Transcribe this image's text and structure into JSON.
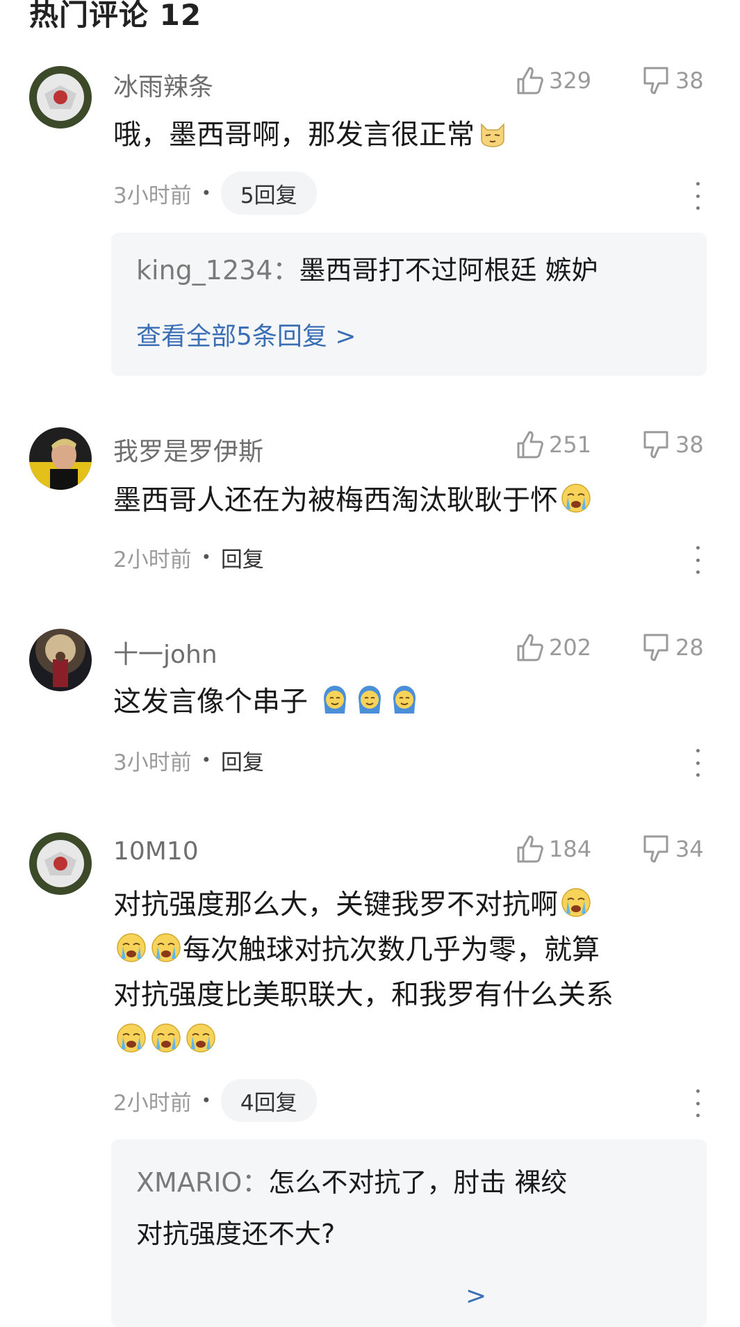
{
  "section": {
    "title": "热门评论 12"
  },
  "comments": [
    {
      "username": "冰雨辣条",
      "likes": "329",
      "dislikes": "38",
      "text": "哦，墨西哥啊，那发言很正常",
      "time": "3小时前",
      "reply_label": "5回复",
      "reply_preview": {
        "user": "king_1234：",
        "text": "墨西哥打不过阿根廷 嫉妒",
        "view_all": "查看全部5条回复 >"
      }
    },
    {
      "username": "我罗是罗伊斯",
      "likes": "251",
      "dislikes": "38",
      "text": "墨西哥人还在为被梅西淘汰耿耿于怀",
      "time": "2小时前",
      "reply_label": "回复"
    },
    {
      "username": "十一john",
      "likes": "202",
      "dislikes": "28",
      "text": "这发言像个串子",
      "time": "3小时前",
      "reply_label": "回复"
    },
    {
      "username": "10M10",
      "likes": "184",
      "dislikes": "34",
      "text_line1": "对抗强度那么大，关键我罗不对抗啊",
      "text_line2": "每次触球对抗次数几乎为零，就算",
      "text_line3": "对抗强度比美职联大，和我罗有什么关系",
      "time": "2小时前",
      "reply_label": "4回复",
      "reply_preview": {
        "user": "XMARIO：",
        "text_line1": "怎么不对抗了，肘击 裸绞",
        "text_line2": "对抗强度还不大?",
        "view_all": ">"
      }
    }
  ],
  "icons": {
    "like": "thumbs-up-outline",
    "dislike": "thumbs-down-outline",
    "more": "vertical-ellipsis",
    "emoji_cat": "smug-cat-emoji",
    "emoji_cry": "crying-emoji",
    "emoji_sweat": "sweat-smile-emoji"
  },
  "colors": {
    "link": "#3b6fb5",
    "muted": "#9a9a9a",
    "reply_bg": "#f5f6f8"
  }
}
